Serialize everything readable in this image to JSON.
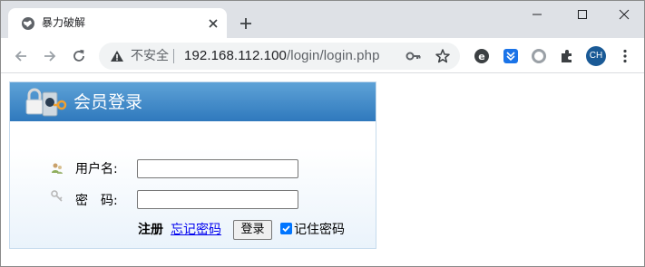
{
  "browser": {
    "tab_title": "暴力破解",
    "omnibox": {
      "security_label": "不安全",
      "url_host": "192.168.112.100",
      "url_path": "/login/login.php"
    },
    "profile_initials": "CH",
    "icons": {
      "favicon": "globe-icon",
      "tab_close": "close-icon",
      "new_tab": "plus-icon",
      "minimize": "minimize-icon",
      "maximize": "maximize-icon",
      "close_window": "close-icon",
      "back": "back-arrow-icon",
      "forward": "forward-arrow-icon",
      "reload": "reload-icon",
      "security": "warning-icon",
      "password": "key-icon",
      "bookmark": "star-icon",
      "extensions": [
        "extension-e-icon",
        "extension-download-icon",
        "extension-circle-icon",
        "puzzle-icon"
      ],
      "menu": "kebab-menu-icon"
    }
  },
  "login": {
    "title": "会员登录",
    "username_label": "用户名:",
    "password_label": "密　码:",
    "username_value": "",
    "password_value": "",
    "register_label": "注册",
    "forgot_label": "忘记密码",
    "submit_label": "登录",
    "remember_label": "记住密码",
    "remember_checked": true
  },
  "colors": {
    "header_top": "#5ea2d7",
    "header_bottom": "#2f79bd",
    "link": "#0000ee",
    "checkbox": "#0075ff",
    "tabstrip": "#dee1e6"
  }
}
